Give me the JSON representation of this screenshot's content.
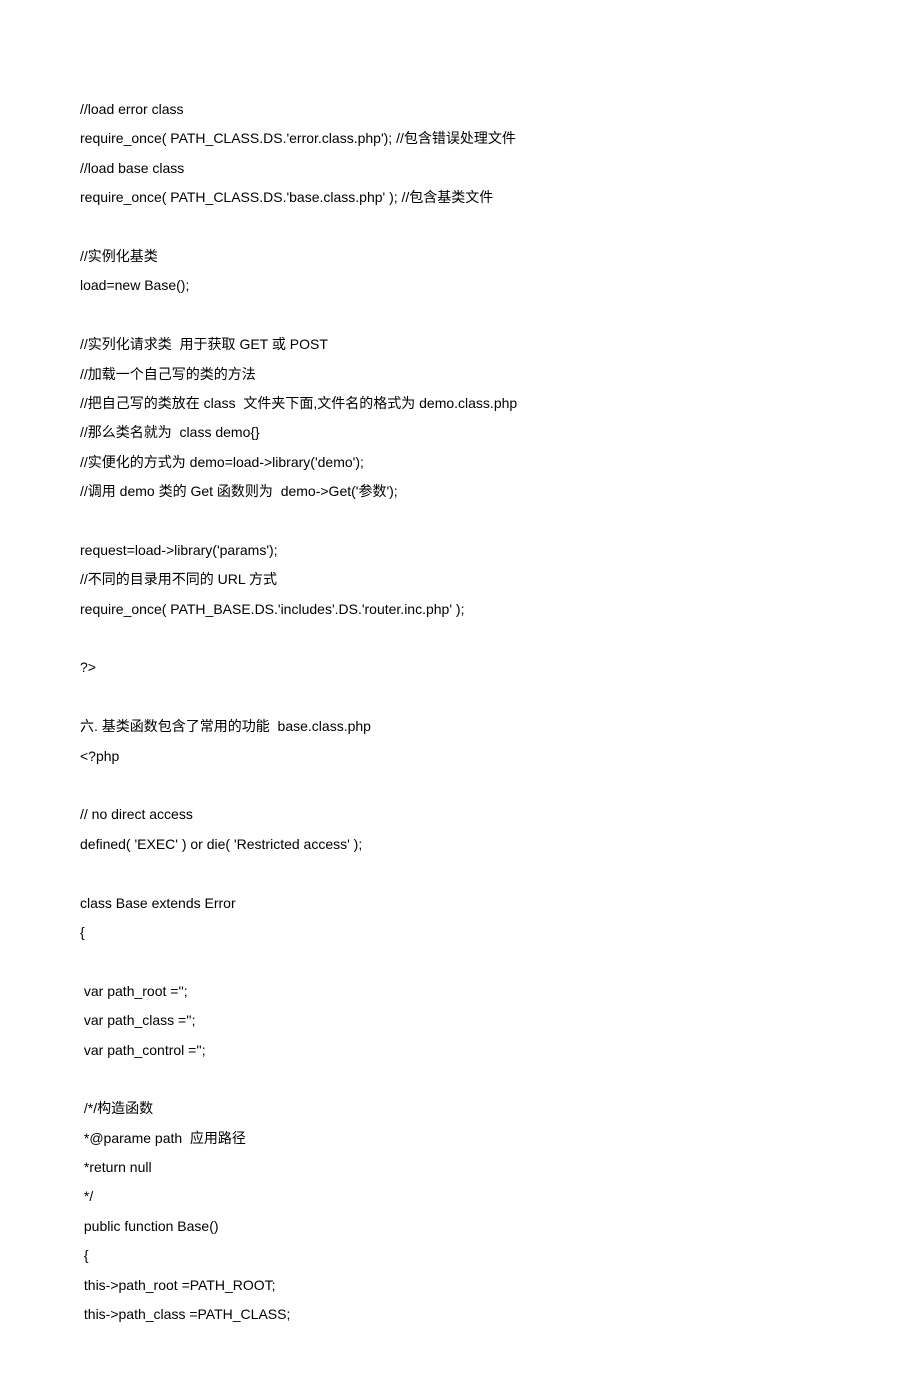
{
  "lines": [
    "//load error class",
    "require_once( PATH_CLASS.DS.'error.class.php'); //包含错误处理文件",
    "//load base class",
    "require_once( PATH_CLASS.DS.'base.class.php' ); //包含基类文件",
    "",
    "//实例化基类",
    "load=new Base();",
    "",
    "//实列化请求类  用于获取 GET 或 POST",
    "//加载一个自己写的类的方法",
    "//把自己写的类放在 class  文件夹下面,文件名的格式为 demo.class.php",
    "//那么类名就为  class demo{}",
    "//实便化的方式为 demo=load->library('demo');",
    "//调用 demo 类的 Get 函数则为  demo->Get('参数');",
    "",
    "request=load->library('params');",
    "//不同的目录用不同的 URL 方式",
    "require_once( PATH_BASE.DS.'includes'.DS.'router.inc.php' );",
    "",
    "?>",
    "",
    "六. 基类函数包含了常用的功能  base.class.php",
    "<?php",
    "",
    "// no direct access",
    "defined( 'EXEC' ) or die( 'Restricted access' );",
    "",
    "class Base extends Error",
    "{",
    "",
    " var path_root ='';",
    " var path_class ='';",
    " var path_control ='';",
    "",
    " /*/构造函数",
    " *@parame path  应用路径",
    " *return null",
    " */",
    " public function Base()",
    " {",
    " this->path_root =PATH_ROOT;",
    " this->path_class =PATH_CLASS;"
  ]
}
